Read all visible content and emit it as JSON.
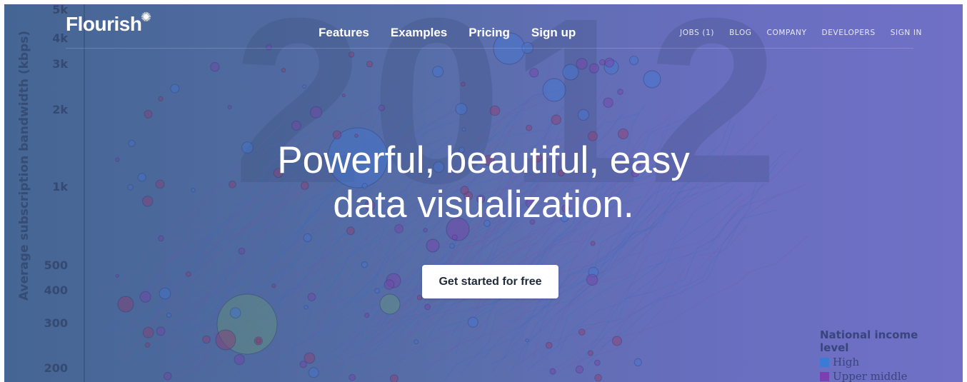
{
  "nav": {
    "logo": "Flourish",
    "main": [
      "Features",
      "Examples",
      "Pricing",
      "Sign up"
    ],
    "secondary": [
      "JOBS (1)",
      "BLOG",
      "COMPANY",
      "DEVELOPERS",
      "SIGN IN"
    ]
  },
  "hero": {
    "headline_line1": "Powerful, beautiful, easy",
    "headline_line2": "data visualization.",
    "cta": "Get started for free"
  },
  "background_chart": {
    "year": "2012",
    "y_axis_title": "Average subscription bandwidth (kbps)",
    "y_ticks": [
      "5k",
      "4k",
      "3k",
      "2k",
      "1k",
      "500",
      "400",
      "300",
      "200"
    ],
    "legend": {
      "title": "National income level",
      "items": [
        {
          "label": "High",
          "color": "#3a7bd5"
        },
        {
          "label": "Upper middle",
          "color": "#7a3fb0"
        }
      ]
    }
  },
  "colors": {
    "hero_start": "#4a6b97",
    "hero_end": "#6f70c6",
    "cta_bg": "#ffffff",
    "cta_text": "#1f2a3a"
  }
}
